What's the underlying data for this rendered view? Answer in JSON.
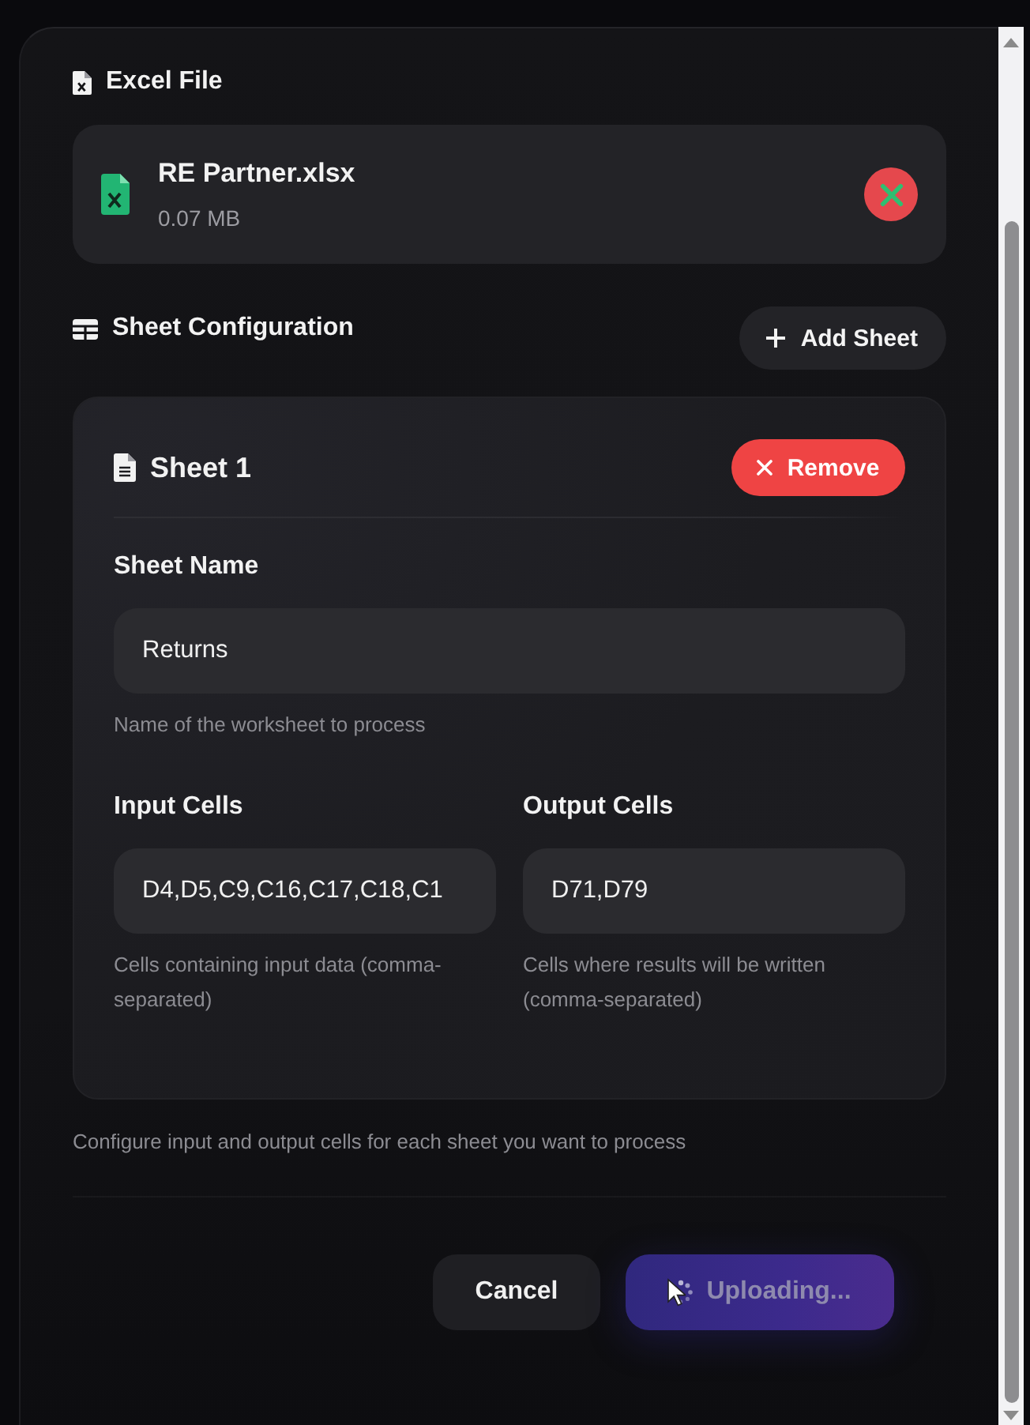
{
  "excel_file": {
    "heading": "Excel File",
    "file": {
      "name": "RE Partner.xlsx",
      "size": "0.07 MB"
    }
  },
  "sheet_configuration": {
    "heading": "Sheet Configuration",
    "add_button": "Add Sheet",
    "sheets": [
      {
        "title": "Sheet 1",
        "remove_button": "Remove",
        "fields": [
          {
            "kind": "wide",
            "label": "Sheet Name",
            "value": "Returns",
            "help": "Name of the worksheet to process"
          },
          {
            "kind": "half",
            "label": "Input Cells",
            "value": "D4,D5,C9,C16,C17,C18,C1",
            "help": "Cells containing input data (comma-separated)"
          },
          {
            "kind": "half",
            "label": "Output Cells",
            "value": "D71,D79",
            "help": "Cells where results will be written (comma-separated)"
          }
        ]
      }
    ],
    "note": "Configure input and output cells for each sheet you want to process"
  },
  "actions": [
    {
      "kind": "secondary",
      "label": "Cancel",
      "disabled": false,
      "loading": false
    },
    {
      "kind": "primary",
      "label": "Uploading...",
      "disabled": true,
      "loading": true
    }
  ]
}
